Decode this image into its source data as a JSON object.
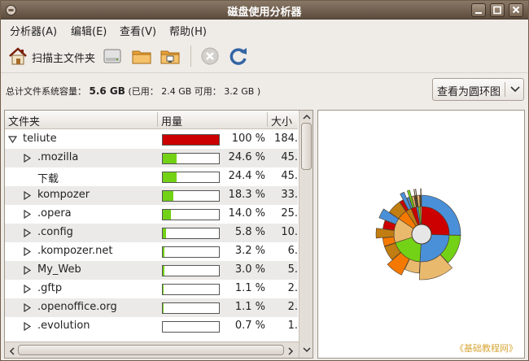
{
  "window": {
    "title": "磁盘使用分析器"
  },
  "menu": [
    "分析器(A)",
    "编辑(E)",
    "查看(V)",
    "帮助(H)"
  ],
  "toolbar": {
    "scan_home_label": "扫描主文件夹"
  },
  "capacity": {
    "label": "总计文件系统容量：",
    "total": "5.6 GB",
    "detail": "(已用： 2.4 GB 可用： 3.2 GB )"
  },
  "view_selector": {
    "value": "查看为圆环图"
  },
  "tree": {
    "columns": {
      "folder": "文件夹",
      "usage": "用量",
      "size": "大小"
    },
    "rows": [
      {
        "name": "teliute",
        "expanded": true,
        "expandable": true,
        "depth": 0,
        "fraction": 1.0,
        "percent": "100 %",
        "size": "184.",
        "color": "#cc0000"
      },
      {
        "name": ".mozilla",
        "expanded": false,
        "expandable": true,
        "depth": 1,
        "fraction": 0.246,
        "percent": "24.6 %",
        "size": "45.",
        "color": "#73d216"
      },
      {
        "name": "下载",
        "expanded": false,
        "expandable": false,
        "depth": 1,
        "fraction": 0.244,
        "percent": "24.4 %",
        "size": "45.",
        "color": "#73d216"
      },
      {
        "name": "kompozer",
        "expanded": false,
        "expandable": true,
        "depth": 1,
        "fraction": 0.183,
        "percent": "18.3 %",
        "size": "33.",
        "color": "#73d216"
      },
      {
        "name": ".opera",
        "expanded": false,
        "expandable": true,
        "depth": 1,
        "fraction": 0.14,
        "percent": "14.0 %",
        "size": "25.",
        "color": "#73d216"
      },
      {
        "name": ".config",
        "expanded": false,
        "expandable": true,
        "depth": 1,
        "fraction": 0.058,
        "percent": "5.8 %",
        "size": "10.",
        "color": "#73d216"
      },
      {
        "name": ".kompozer.net",
        "expanded": false,
        "expandable": true,
        "depth": 1,
        "fraction": 0.032,
        "percent": "3.2 %",
        "size": "6.",
        "color": "#73d216"
      },
      {
        "name": "My_Web",
        "expanded": false,
        "expandable": true,
        "depth": 1,
        "fraction": 0.03,
        "percent": "3.0 %",
        "size": "5.",
        "color": "#73d216"
      },
      {
        "name": ".gftp",
        "expanded": false,
        "expandable": true,
        "depth": 1,
        "fraction": 0.011,
        "percent": "1.1 %",
        "size": "2.",
        "color": "#73d216"
      },
      {
        "name": ".openoffice.org",
        "expanded": false,
        "expandable": true,
        "depth": 1,
        "fraction": 0.011,
        "percent": "1.1 %",
        "size": "2.",
        "color": "#73d216"
      },
      {
        "name": ".evolution",
        "expanded": false,
        "expandable": true,
        "depth": 1,
        "fraction": 0.007,
        "percent": "0.7 %",
        "size": "1.",
        "color": "#73d216"
      }
    ]
  },
  "watermark": "《基础教程网》",
  "ring_colors": [
    "#cc0000",
    "#4a90d9",
    "#73d216",
    "#e9b96e",
    "#f57900",
    "#c17d11"
  ]
}
